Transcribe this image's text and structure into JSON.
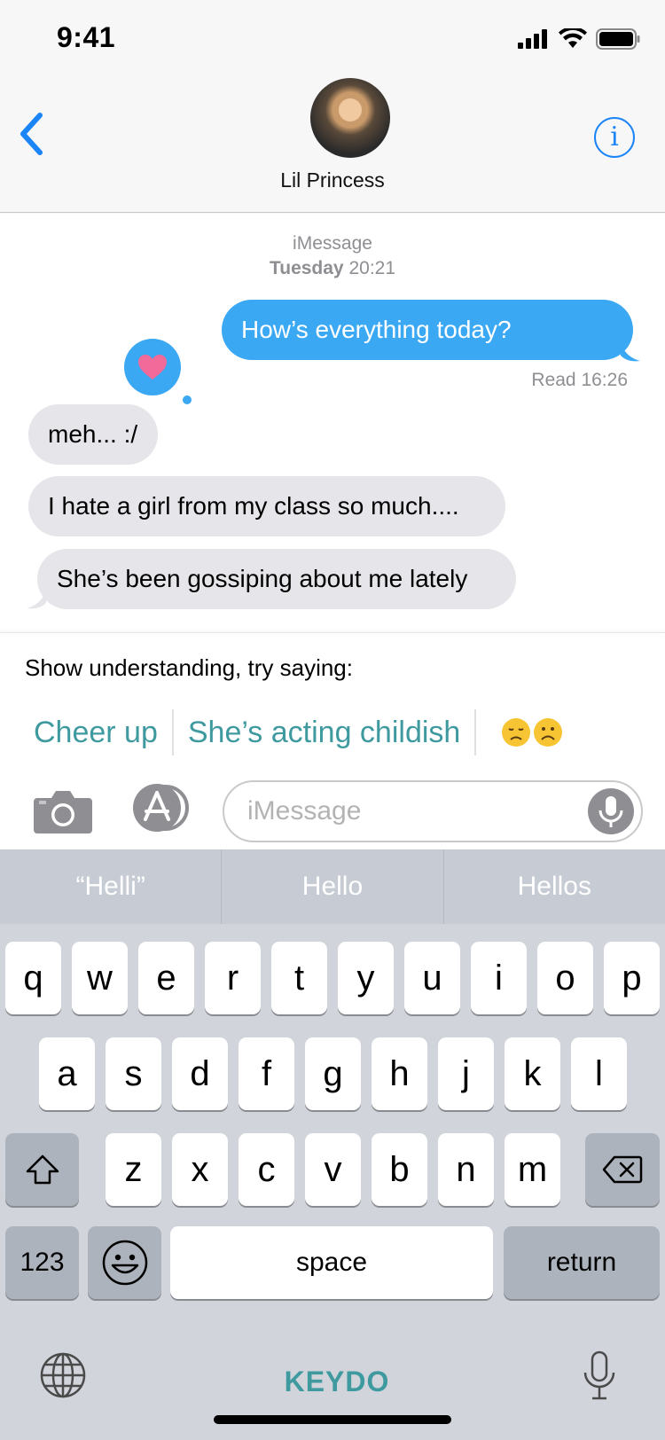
{
  "status_bar": {
    "time": "9:41"
  },
  "header": {
    "contact_name": "Lil Princess"
  },
  "conversation": {
    "service": "iMessage",
    "day": "Tuesday",
    "time": "20:21",
    "messages": [
      {
        "from": "me",
        "text": "How’s everything today?"
      },
      {
        "from": "them",
        "text": "meh... :/"
      },
      {
        "from": "them",
        "text": "I hate a girl from my class so much...."
      },
      {
        "from": "them",
        "text": "She’s been gossiping about me lately"
      }
    ],
    "read_receipt": "Read 16:26",
    "tapback": "heart"
  },
  "suggestions": {
    "prompt": "Show understanding, try saying:",
    "chips": [
      "Cheer up",
      "She’s acting childish"
    ],
    "emoji": "😞☹️"
  },
  "compose": {
    "placeholder": "iMessage",
    "value": ""
  },
  "keyboard": {
    "predictions": [
      "“Helli”",
      "Hello",
      "Hellos"
    ],
    "row1": [
      "q",
      "w",
      "e",
      "r",
      "t",
      "y",
      "u",
      "i",
      "o",
      "p"
    ],
    "row2": [
      "a",
      "s",
      "d",
      "f",
      "g",
      "h",
      "j",
      "k",
      "l"
    ],
    "row3": [
      "z",
      "x",
      "c",
      "v",
      "b",
      "n",
      "m"
    ],
    "numbers_label": "123",
    "space_label": "space",
    "return_label": "return",
    "brand": "KEYDO"
  },
  "colors": {
    "accent": "#3f9aa0",
    "sent_bubble": "#3ba8f4",
    "ios_blue": "#1b84f7"
  }
}
